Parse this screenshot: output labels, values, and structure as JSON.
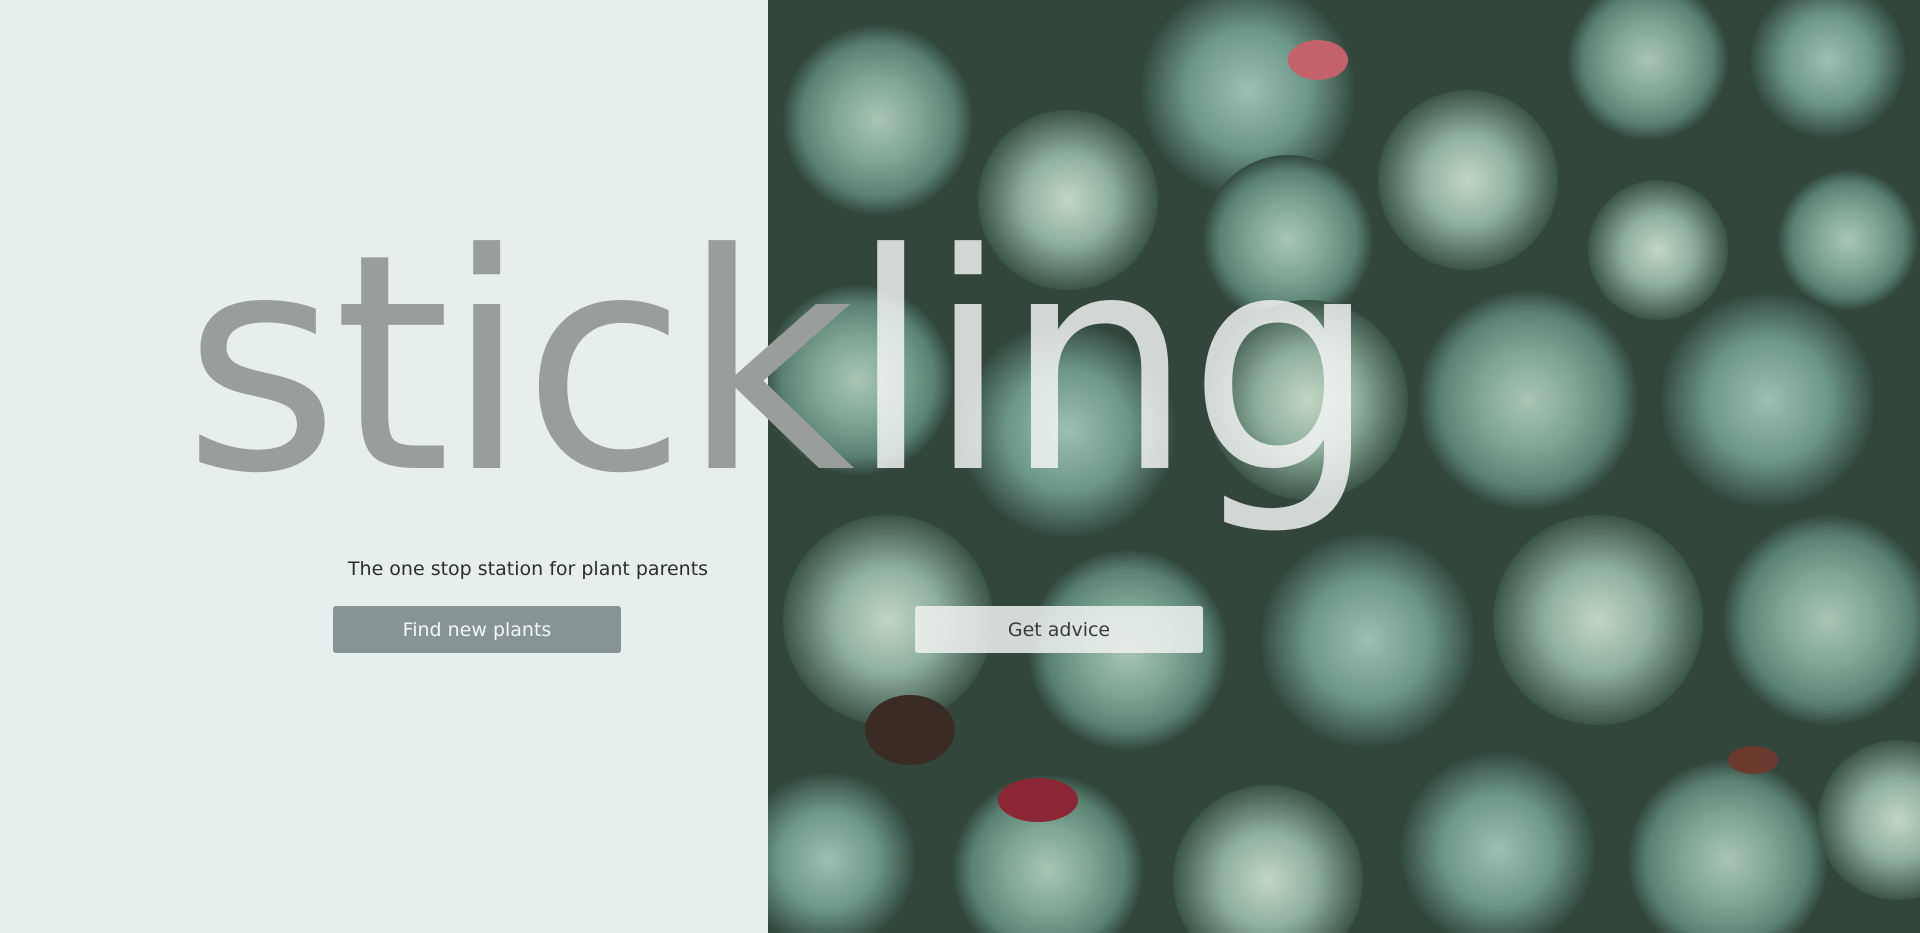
{
  "brand": {
    "wordmark_dark": "stick",
    "wordmark_light": "ling"
  },
  "hero": {
    "tagline": "The one stop station for plant parents",
    "primary_button_label": "Find new plants",
    "secondary_button_label": "Get advice",
    "image": "succulents-photo"
  },
  "colors": {
    "left_panel_bg": "#e7efee",
    "wordmark_dark": "#9a9e9a",
    "primary_button_bg": "#869493",
    "secondary_button_bg": "#eef1f0"
  }
}
